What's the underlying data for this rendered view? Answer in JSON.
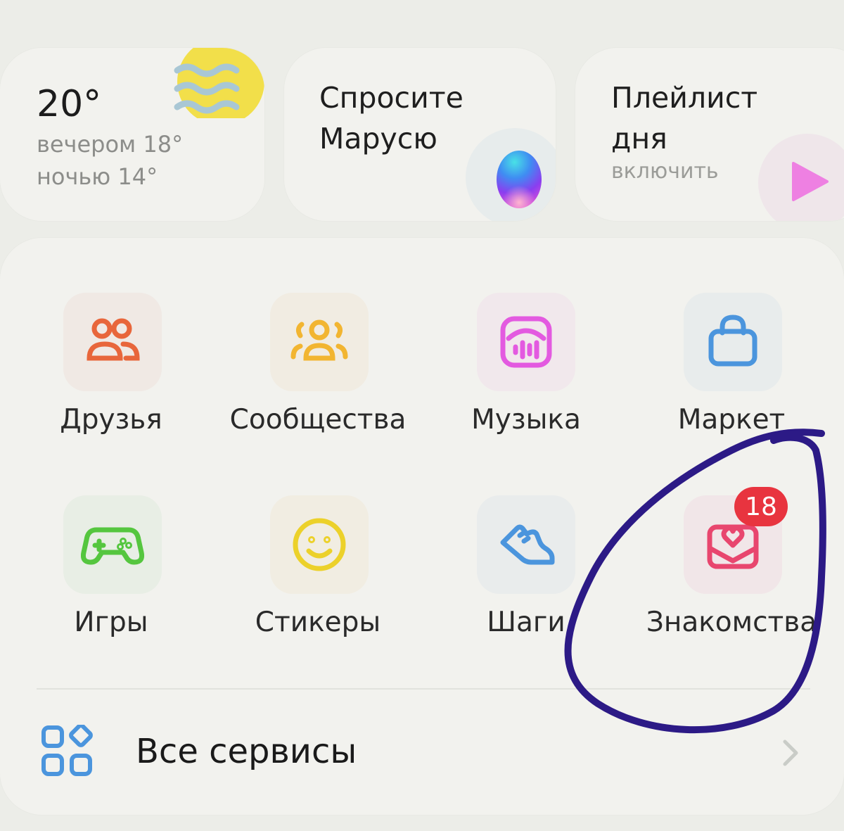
{
  "widgets": {
    "weather": {
      "temperature": "20°",
      "evening": "вечером 18°",
      "night": "ночью 14°",
      "icon": "sun-with-wind-icon"
    },
    "assistant": {
      "title": "Спросите Марусю",
      "icon": "marusia-orb-icon"
    },
    "playlist": {
      "title": "Плейлист дня",
      "action": "включить",
      "icon": "play-icon"
    }
  },
  "services": [
    {
      "label": "Друзья",
      "icon": "friends-icon",
      "color": "#e8663b"
    },
    {
      "label": "Сообщества",
      "icon": "communities-icon",
      "color": "#f2b531"
    },
    {
      "label": "Музыка",
      "icon": "music-icon",
      "color": "#e35ae0"
    },
    {
      "label": "Маркет",
      "icon": "market-bag-icon",
      "color": "#4b95dd"
    },
    {
      "label": "Игры",
      "icon": "gamepad-icon",
      "color": "#55c63f"
    },
    {
      "label": "Стикеры",
      "icon": "smile-sticker-icon",
      "color": "#ecd12a"
    },
    {
      "label": "Шаги",
      "icon": "sneaker-icon",
      "color": "#4b95dd"
    },
    {
      "label": "Знакомства",
      "icon": "dating-envelope-heart-icon",
      "color": "#e8466e",
      "badge": "18"
    }
  ],
  "all_services": {
    "label": "Все сервисы",
    "icon": "grid-apps-icon",
    "chevron": "chevron-right-icon"
  },
  "annotation": {
    "stroke_color": "#2c1a86",
    "target": "Знакомства"
  }
}
